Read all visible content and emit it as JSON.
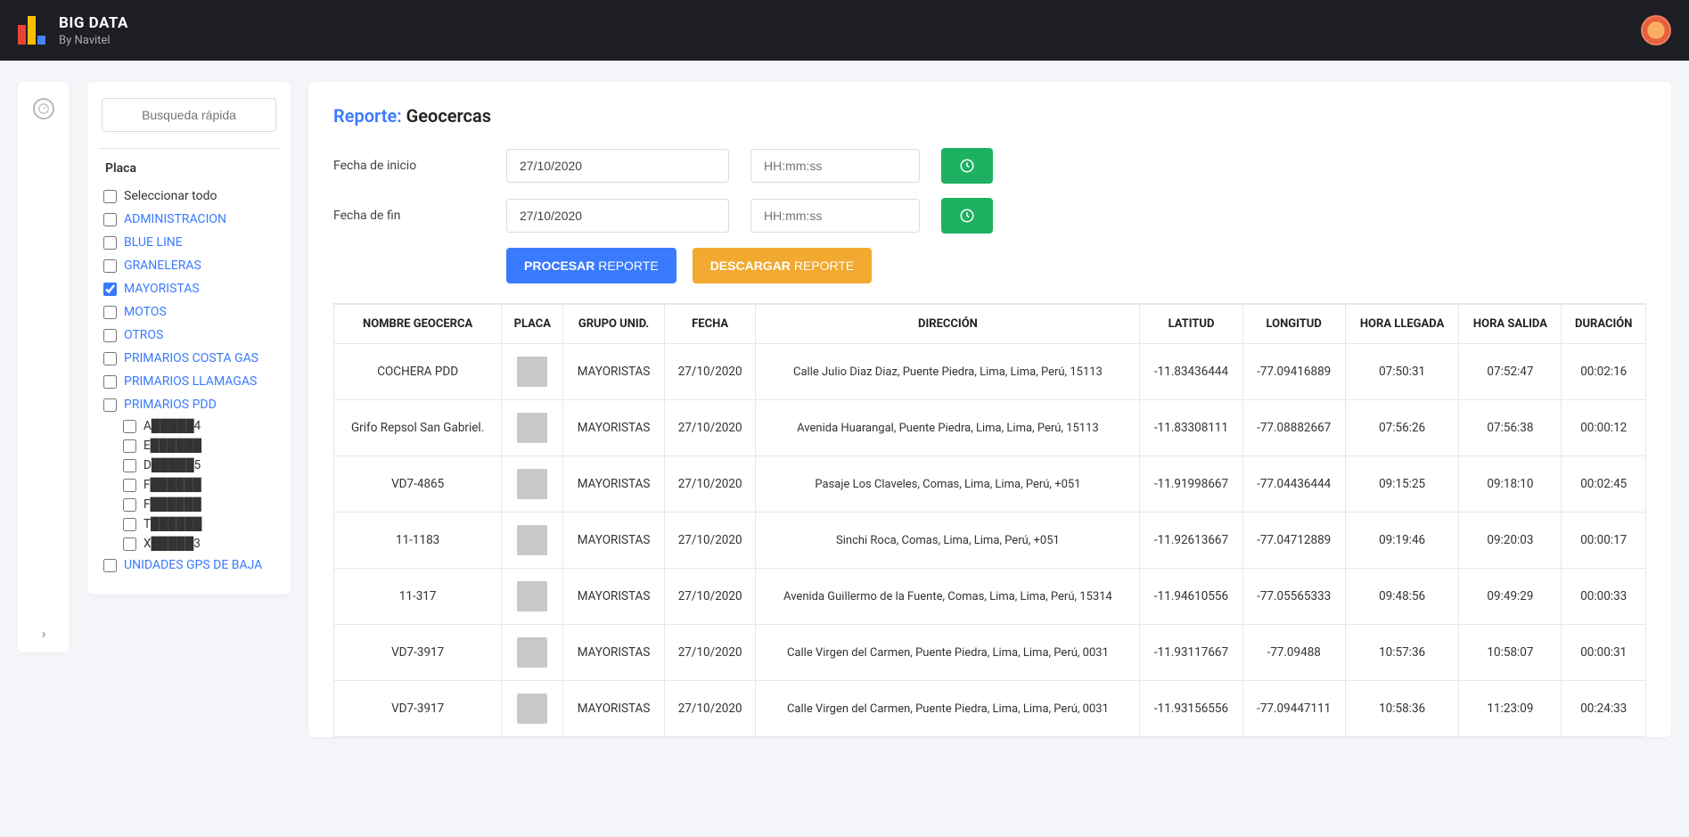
{
  "brand": {
    "title": "BIG DATA",
    "subtitle": "By Navitel"
  },
  "sidebar": {
    "search_placeholder": "Busqueda rápida",
    "header": "Placa",
    "groups": [
      {
        "label": "Seleccionar todo",
        "checked": false,
        "link": false
      },
      {
        "label": "ADMINISTRACION",
        "checked": false,
        "link": true
      },
      {
        "label": "BLUE LINE",
        "checked": false,
        "link": true
      },
      {
        "label": "GRANELERAS",
        "checked": false,
        "link": true
      },
      {
        "label": "MAYORISTAS",
        "checked": true,
        "link": true
      },
      {
        "label": "MOTOS",
        "checked": false,
        "link": true
      },
      {
        "label": "OTROS",
        "checked": false,
        "link": true
      },
      {
        "label": "PRIMARIOS COSTA GAS",
        "checked": false,
        "link": true
      },
      {
        "label": "PRIMARIOS LLAMAGAS",
        "checked": false,
        "link": true
      },
      {
        "label": "PRIMARIOS PDD",
        "checked": false,
        "link": true
      }
    ],
    "sub_items": [
      {
        "label": "A█████4"
      },
      {
        "label": "E██████"
      },
      {
        "label": "D█████5"
      },
      {
        "label": "F██████"
      },
      {
        "label": "F██████"
      },
      {
        "label": "T██████"
      },
      {
        "label": "X█████3"
      }
    ],
    "last_group": {
      "label": "UNIDADES GPS DE BAJA",
      "checked": false,
      "link": true
    }
  },
  "report": {
    "title_prefix": "Reporte:",
    "title_suffix": "Geocercas",
    "start_label": "Fecha de inicio",
    "end_label": "Fecha de fin",
    "start_date": "27/10/2020",
    "end_date": "27/10/2020",
    "time_placeholder": "HH:mm:ss",
    "process_bold": "PROCESAR",
    "process_rest": "REPORTE",
    "download_bold": "DESCARGAR",
    "download_rest": "REPORTE"
  },
  "table": {
    "headers": {
      "nombre": "NOMBRE GEOCERCA",
      "placa": "PLACA",
      "grupo": "GRUPO UNID.",
      "fecha": "FECHA",
      "direccion": "DIRECCIÓN",
      "latitud": "LATITUD",
      "longitud": "LONGITUD",
      "llegada": "HORA LLEGADA",
      "salida": "HORA SALIDA",
      "duracion": "DURACIÓN"
    },
    "rows": [
      {
        "nombre": "COCHERA PDD",
        "grupo": "MAYORISTAS",
        "fecha": "27/10/2020",
        "direccion": "Calle Julio Diaz Diaz, Puente Piedra, Lima, Lima, Perú, 15113",
        "lat": "-11.83436444",
        "lon": "-77.09416889",
        "llegada": "07:50:31",
        "salida": "07:52:47",
        "dur": "00:02:16"
      },
      {
        "nombre": "Grifo Repsol San Gabriel.",
        "grupo": "MAYORISTAS",
        "fecha": "27/10/2020",
        "direccion": "Avenida Huarangal, Puente Piedra, Lima, Lima, Perú, 15113",
        "lat": "-11.83308111",
        "lon": "-77.08882667",
        "llegada": "07:56:26",
        "salida": "07:56:38",
        "dur": "00:00:12"
      },
      {
        "nombre": "VD7-4865",
        "grupo": "MAYORISTAS",
        "fecha": "27/10/2020",
        "direccion": "Pasaje Los Claveles, Comas, Lima, Lima, Perú, +051",
        "lat": "-11.91998667",
        "lon": "-77.04436444",
        "llegada": "09:15:25",
        "salida": "09:18:10",
        "dur": "00:02:45"
      },
      {
        "nombre": "11-1183",
        "grupo": "MAYORISTAS",
        "fecha": "27/10/2020",
        "direccion": "Sinchi Roca, Comas, Lima, Lima, Perú, +051",
        "lat": "-11.92613667",
        "lon": "-77.04712889",
        "llegada": "09:19:46",
        "salida": "09:20:03",
        "dur": "00:00:17"
      },
      {
        "nombre": "11-317",
        "grupo": "MAYORISTAS",
        "fecha": "27/10/2020",
        "direccion": "Avenida Guillermo de la Fuente, Comas, Lima, Lima, Perú, 15314",
        "lat": "-11.94610556",
        "lon": "-77.05565333",
        "llegada": "09:48:56",
        "salida": "09:49:29",
        "dur": "00:00:33"
      },
      {
        "nombre": "VD7-3917",
        "grupo": "MAYORISTAS",
        "fecha": "27/10/2020",
        "direccion": "Calle Virgen del Carmen, Puente Piedra, Lima, Lima, Perú, 0031",
        "lat": "-11.93117667",
        "lon": "-77.09488",
        "llegada": "10:57:36",
        "salida": "10:58:07",
        "dur": "00:00:31"
      },
      {
        "nombre": "VD7-3917",
        "grupo": "MAYORISTAS",
        "fecha": "27/10/2020",
        "direccion": "Calle Virgen del Carmen, Puente Piedra, Lima, Lima, Perú, 0031",
        "lat": "-11.93156556",
        "lon": "-77.09447111",
        "llegada": "10:58:36",
        "salida": "11:23:09",
        "dur": "00:24:33"
      }
    ]
  }
}
